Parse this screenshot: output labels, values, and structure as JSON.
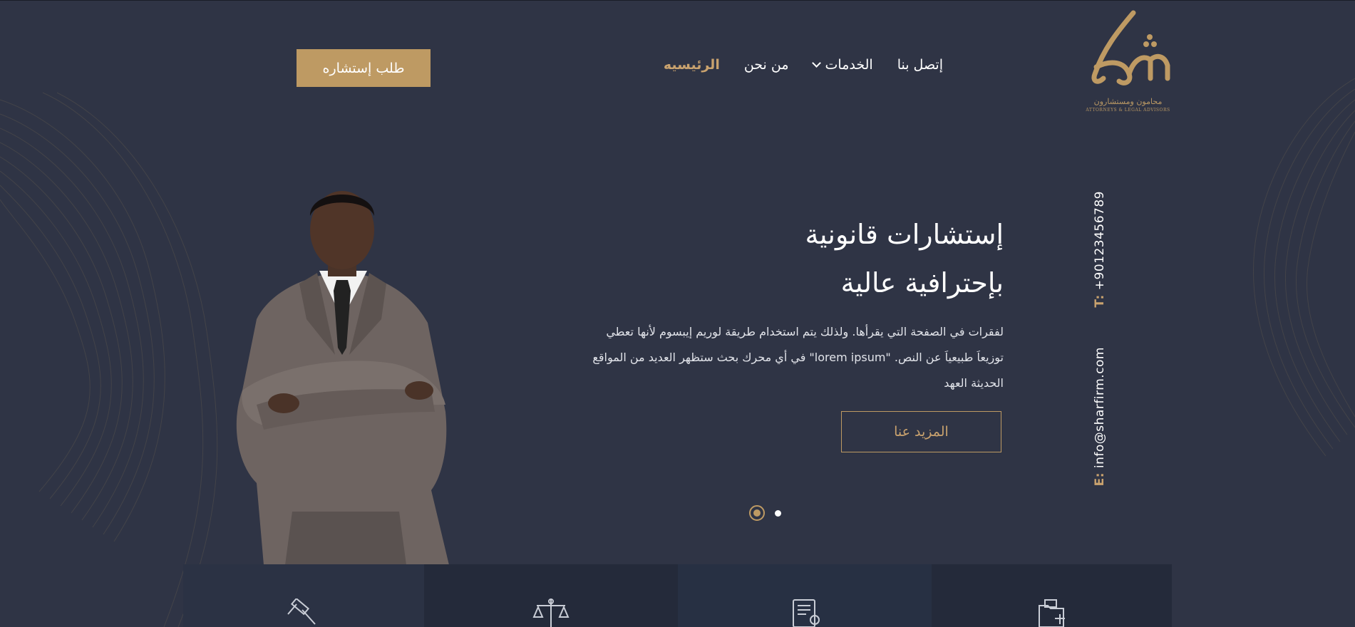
{
  "brand": {
    "logo_arabic": "محامون ومستشارون",
    "logo_english": "ATTORNEYS & LEGAL ADVISORS",
    "accent_color": "#be9a63",
    "background_color": "#2f3445"
  },
  "nav": {
    "items": [
      {
        "label": "الرئيسيه",
        "active": true
      },
      {
        "label": "من نحن",
        "active": false
      },
      {
        "label": "الخدمات",
        "active": false,
        "has_dropdown": true
      },
      {
        "label": "إتصل بنا",
        "active": false
      }
    ],
    "cta_label": "طلب إستشاره"
  },
  "hero": {
    "title_line1": "إستشارات قانونية",
    "title_line2": "بإحترافية عالية",
    "desc_line1": "لفقرات في الصفحة التي يقرأها. ولذلك يتم استخدام طريقة لوريم إيبسوم لأنها تعطي",
    "desc_line2": "توزيعاَ طبيعياَ عن النص. \"lorem ipsum\" في أي محرك بحث ستظهر العديد من المواقع",
    "desc_line3": "الحديثة العهد",
    "more_label": "المزيد عنا"
  },
  "slider": {
    "active_index": 0,
    "count": 2
  },
  "contact": {
    "phone_label": "T:",
    "phone": "+9012345678​9",
    "email_label": "E:",
    "email": "info@sharfirm.com"
  },
  "features": {
    "icons": [
      "gavel-icon",
      "scales-icon",
      "document-certificate-icon",
      "legal-folder-icon"
    ]
  }
}
